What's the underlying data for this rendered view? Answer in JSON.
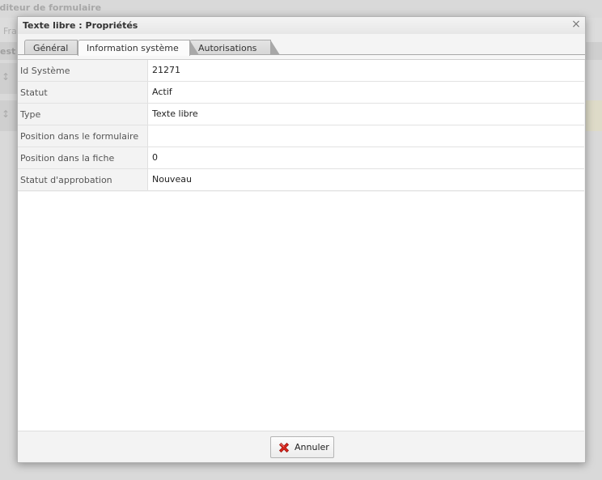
{
  "background": {
    "window_title": "Éditeur de formulaire",
    "toolbar_text": "Fra",
    "header_text": "est"
  },
  "modal": {
    "title": "Texte libre : Propriétés",
    "close_glyph": "×"
  },
  "tabs": [
    {
      "label": "Général",
      "active": false
    },
    {
      "label": "Information système",
      "active": true
    },
    {
      "label": "Autorisations",
      "active": false
    }
  ],
  "properties": [
    {
      "key": "Id Système",
      "value": "21271"
    },
    {
      "key": "Statut",
      "value": "Actif"
    },
    {
      "key": "Type",
      "value": "Texte libre"
    },
    {
      "key": "Position dans le formulaire",
      "value": ""
    },
    {
      "key": "Position dans la fiche",
      "value": "0"
    },
    {
      "key": "Statut d'approbation",
      "value": "Nouveau"
    }
  ],
  "footer": {
    "cancel_label": "Annuler",
    "cancel_icon": "red-x-icon"
  },
  "colors": {
    "cancel_icon": "#d9261c"
  }
}
